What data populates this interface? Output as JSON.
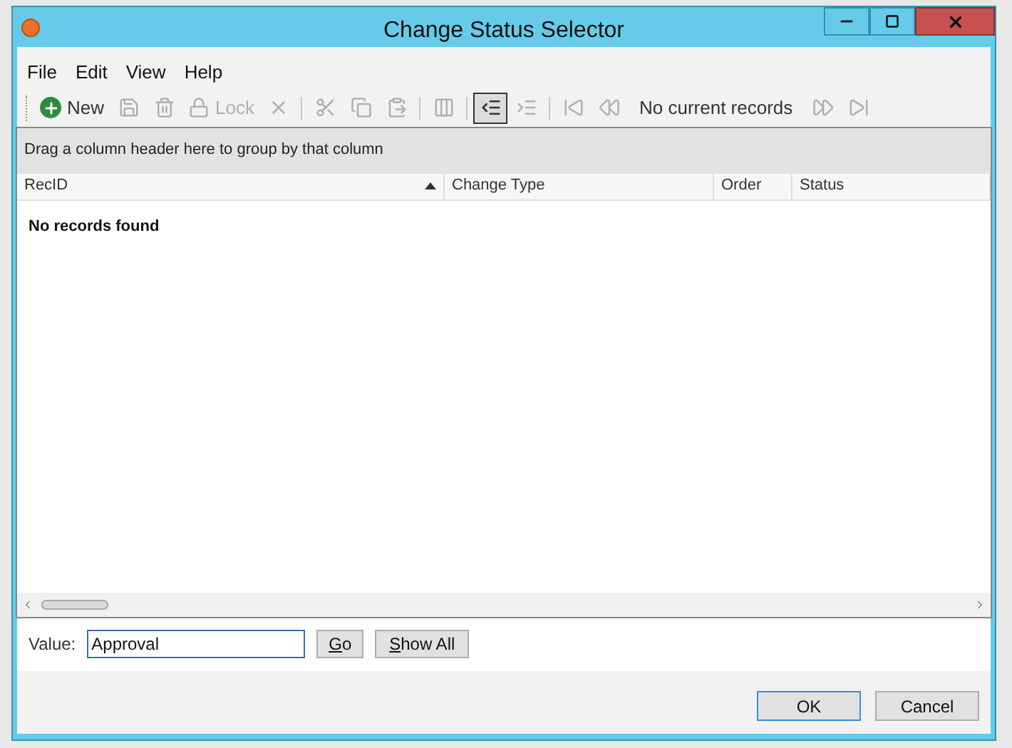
{
  "window": {
    "title": "Change Status Selector"
  },
  "menu": [
    {
      "label": "File"
    },
    {
      "label": "Edit"
    },
    {
      "label": "View"
    },
    {
      "label": "Help"
    }
  ],
  "toolbar": [
    {
      "kind": "new",
      "label": "New",
      "disabled": false
    },
    {
      "kind": "save",
      "disabled": true
    },
    {
      "kind": "delete",
      "disabled": true
    },
    {
      "kind": "lock",
      "label": "Lock",
      "disabled": true
    },
    {
      "kind": "cancel",
      "disabled": true
    },
    {
      "kind": "sep"
    },
    {
      "kind": "cut",
      "disabled": true
    },
    {
      "kind": "copy",
      "disabled": true
    },
    {
      "kind": "paste",
      "disabled": true
    },
    {
      "kind": "sep"
    },
    {
      "kind": "columns",
      "disabled": true
    },
    {
      "kind": "sep"
    },
    {
      "kind": "outdent",
      "disabled": false,
      "pressed": true
    },
    {
      "kind": "indent",
      "disabled": true,
      "pressed": false
    },
    {
      "kind": "sep"
    },
    {
      "kind": "first",
      "disabled": true
    },
    {
      "kind": "prev",
      "disabled": true
    },
    {
      "kind": "status",
      "label": "No current records"
    },
    {
      "kind": "next",
      "disabled": true
    },
    {
      "kind": "last",
      "disabled": true
    }
  ],
  "group_panel": {
    "text": "Drag a column header here to group by that column"
  },
  "table": {
    "columns": [
      {
        "label": "RecID",
        "sorted": true
      },
      {
        "label": "Change Type",
        "sorted": false
      },
      {
        "label": "Order",
        "sorted": false
      },
      {
        "label": "Status",
        "sorted": false
      }
    ],
    "empty_text": "No records found"
  },
  "filter": {
    "label": "Value:",
    "value": "Approval",
    "go": "Go",
    "show_all": "Show All"
  },
  "buttons": [
    {
      "label": "OK",
      "default": true
    },
    {
      "label": "Cancel",
      "default": false
    }
  ]
}
